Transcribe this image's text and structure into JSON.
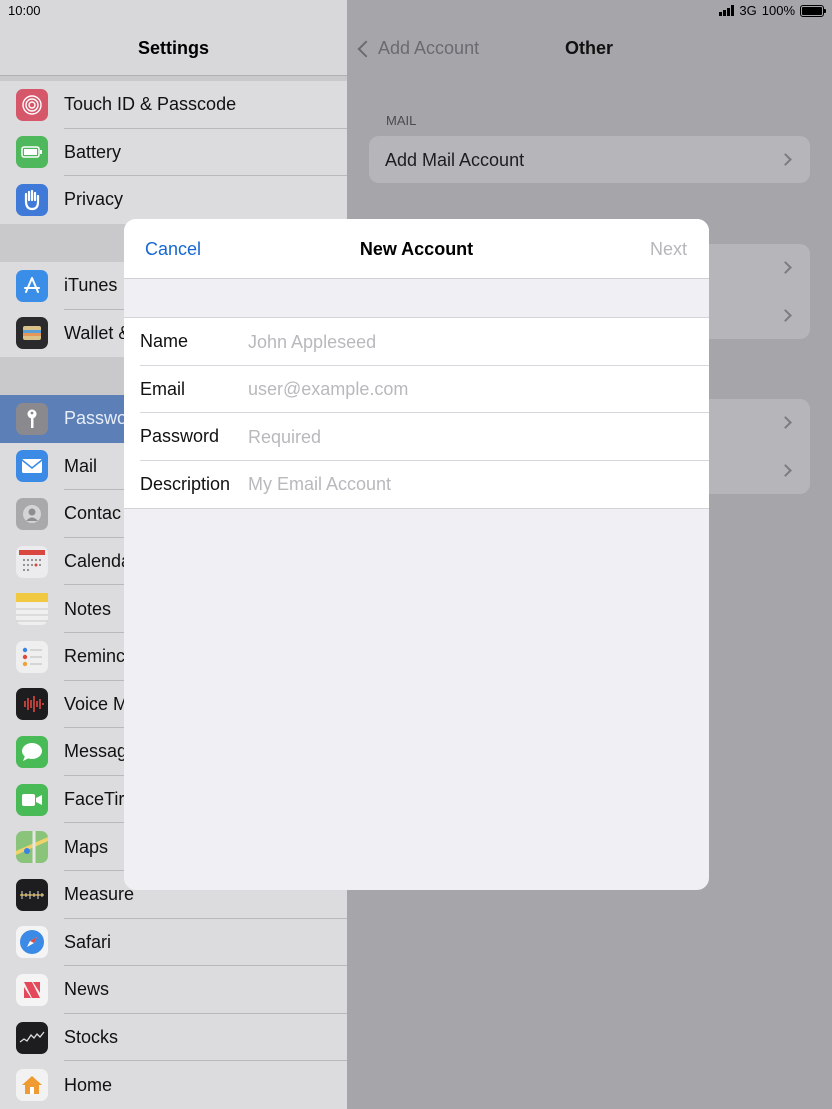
{
  "status": {
    "time": "10:00",
    "network": "3G",
    "battery": "100%"
  },
  "master": {
    "title": "Settings",
    "groups": [
      {
        "items": [
          {
            "label": "Touch ID & Passcode",
            "icon": "fingerprint-icon",
            "color": "#e2344e"
          },
          {
            "label": "Battery",
            "icon": "battery-icon",
            "color": "#3fb952"
          },
          {
            "label": "Privacy",
            "icon": "hand-icon",
            "color": "#2b79e4"
          }
        ]
      },
      {
        "items": [
          {
            "label": "iTunes",
            "icon": "app-store-icon",
            "color": "#2a8cf0"
          },
          {
            "label": "Wallet &",
            "icon": "wallet-icon",
            "color": "#1a1a1a"
          }
        ]
      },
      {
        "items": [
          {
            "label": "Passwo",
            "icon": "key-icon",
            "color": "#7d7d80"
          },
          {
            "label": "Mail",
            "icon": "mail-icon",
            "color": "#2d86ef"
          },
          {
            "label": "Contac",
            "icon": "contacts-icon",
            "color": "#a8a8aa"
          },
          {
            "label": "Calenda",
            "icon": "calendar-icon",
            "color": "#f4f4f4"
          },
          {
            "label": "Notes",
            "icon": "notes-icon",
            "color": "#f6d24a"
          },
          {
            "label": "Reminc",
            "icon": "reminders-icon",
            "color": "#f4f4f4"
          },
          {
            "label": "Voice M",
            "icon": "voice-memos-icon",
            "color": "#1c1c1c"
          },
          {
            "label": "Messag",
            "icon": "messages-icon",
            "color": "#3fc150"
          },
          {
            "label": "FaceTir",
            "icon": "facetime-icon",
            "color": "#3fc150"
          },
          {
            "label": "Maps",
            "icon": "maps-icon",
            "color": "#7ac36a"
          },
          {
            "label": "Measure",
            "icon": "measure-icon",
            "color": "#1c1c1c"
          },
          {
            "label": "Safari",
            "icon": "safari-icon",
            "color": "#2b86ee"
          },
          {
            "label": "News",
            "icon": "news-icon",
            "color": "#f4f4f4"
          },
          {
            "label": "Stocks",
            "icon": "stocks-icon",
            "color": "#1c1c1c"
          },
          {
            "label": "Home",
            "icon": "home-icon",
            "color": "#f5f5f5"
          }
        ]
      }
    ]
  },
  "detail": {
    "back_label": "Add Account",
    "title": "Other",
    "section_header": "MAIL",
    "add_mail_label": "Add Mail Account"
  },
  "modal": {
    "cancel_label": "Cancel",
    "title": "New Account",
    "next_label": "Next",
    "fields": [
      {
        "label": "Name",
        "placeholder": "John Appleseed"
      },
      {
        "label": "Email",
        "placeholder": "user@example.com"
      },
      {
        "label": "Password",
        "placeholder": "Required"
      },
      {
        "label": "Description",
        "placeholder": "My Email Account"
      }
    ]
  }
}
